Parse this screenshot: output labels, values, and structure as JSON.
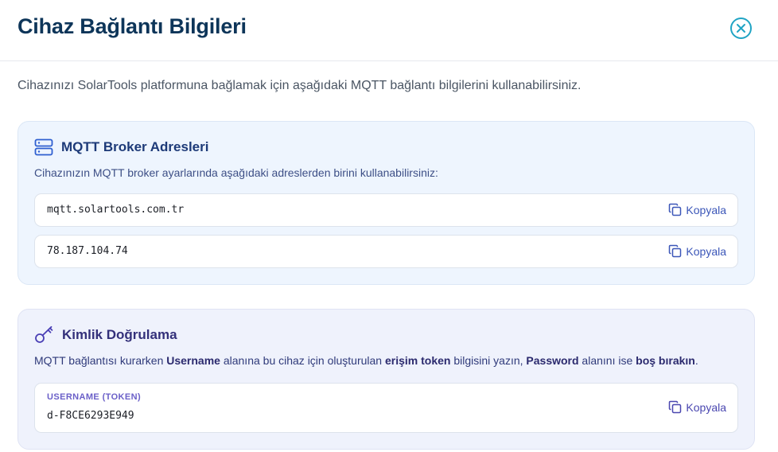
{
  "dialog": {
    "title": "Cihaz Bağlantı Bilgileri",
    "close_icon": "close-icon",
    "accent_color": "#20a4c4"
  },
  "intro": "Cihazınızı SolarTools platformuna bağlamak için aşağıdaki MQTT bağlantı bilgilerini kullanabilirsiniz.",
  "broker": {
    "icon": "server-icon",
    "title": "MQTT Broker Adresleri",
    "description": "Cihazınızın MQTT broker ayarlarında aşağıdaki adreslerden birini kullanabilirsiniz:",
    "addresses": [
      {
        "value": "mqtt.solartools.com.tr",
        "copy_label": "Kopyala"
      },
      {
        "value": "78.187.104.74",
        "copy_label": "Kopyala"
      }
    ]
  },
  "auth": {
    "icon": "key-icon",
    "title": "Kimlik Doğrulama",
    "description_parts": [
      "MQTT bağlantısı kurarken ",
      "Username",
      " alanına bu cihaz için oluşturulan ",
      "erişim token",
      " bilgisini yazın, ",
      "Password",
      " alanını ise ",
      "boş bırakın",
      "."
    ],
    "username": {
      "label": "USERNAME (TOKEN)",
      "value": "d-F8CE6293E949",
      "copy_label": "Kopyala"
    }
  }
}
